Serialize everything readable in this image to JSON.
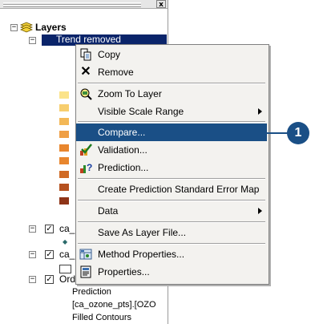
{
  "toc": {
    "root_label": "Layers",
    "selected_layer": "Trend removed",
    "layers": [
      {
        "label": "ca_"
      },
      {
        "label": "ca_"
      },
      {
        "label": "Ord"
      }
    ],
    "legend_lines": [
      "Prediction",
      "[ca_ozone_pts].[OZO",
      "Filled Contours"
    ],
    "swatch_colors": [
      "#fbe38a",
      "#f7ce6e",
      "#f3b857",
      "#ef9f45",
      "#e8862e",
      "#d06a24",
      "#b5511f",
      "#8e3417"
    ]
  },
  "menu": {
    "items": [
      {
        "label": "Copy",
        "icon": "copy-icon"
      },
      {
        "label": "Remove",
        "icon": "remove-icon"
      },
      {
        "label": "Zoom To Layer",
        "icon": "zoom-to-layer-icon"
      },
      {
        "label": "Visible Scale Range",
        "icon": "",
        "submenu": true
      },
      {
        "label": "Compare...",
        "icon": "",
        "highlighted": true
      },
      {
        "label": "Validation...",
        "icon": "validation-icon"
      },
      {
        "label": "Prediction...",
        "icon": "prediction-icon"
      },
      {
        "label": "Create Prediction Standard Error Map",
        "icon": ""
      },
      {
        "label": "Data",
        "icon": "",
        "submenu": true
      },
      {
        "label": "Save As Layer File...",
        "icon": ""
      },
      {
        "label": "Method Properties...",
        "icon": "method-properties-icon"
      },
      {
        "label": "Properties...",
        "icon": "properties-icon"
      }
    ]
  },
  "callout": {
    "number": "1",
    "color": "#1a4f86"
  },
  "close_glyph": "x",
  "highlight_color": "#1a4f86"
}
